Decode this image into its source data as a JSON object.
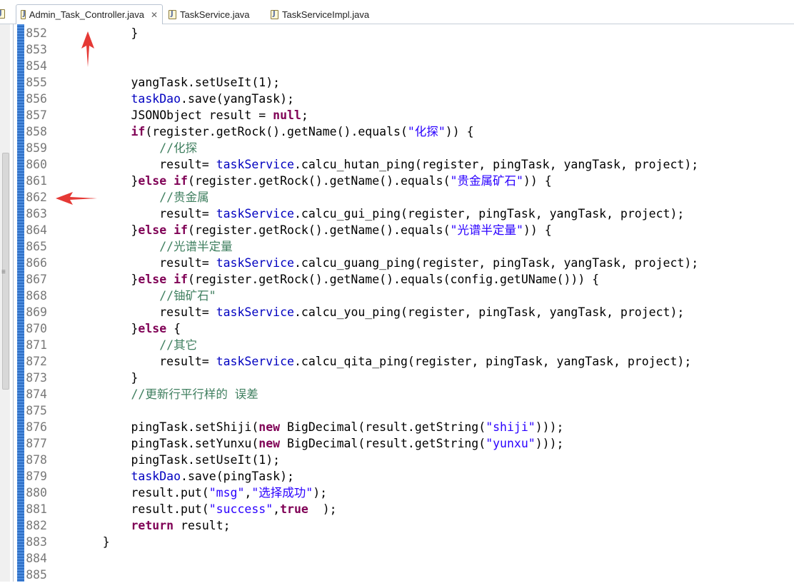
{
  "tabs": [
    {
      "label": "Admin_Task_Controller.java",
      "active": true
    },
    {
      "label": "TaskService.java",
      "active": false
    },
    {
      "label": "TaskServiceImpl.java",
      "active": false
    }
  ],
  "editor": {
    "lines": [
      {
        "n": "852",
        "segs": [
          {
            "t": "        }",
            "c": ""
          }
        ]
      },
      {
        "n": "853",
        "segs": []
      },
      {
        "n": "854",
        "segs": []
      },
      {
        "n": "855",
        "segs": [
          {
            "t": "        yangTask.setUseIt(1);",
            "c": ""
          }
        ]
      },
      {
        "n": "856",
        "segs": [
          {
            "t": "        ",
            "c": ""
          },
          {
            "t": "taskDao",
            "c": "fld"
          },
          {
            "t": ".save(yangTask);",
            "c": ""
          }
        ]
      },
      {
        "n": "857",
        "segs": [
          {
            "t": "        JSONObject result = ",
            "c": ""
          },
          {
            "t": "null",
            "c": "kw"
          },
          {
            "t": ";",
            "c": ""
          }
        ]
      },
      {
        "n": "858",
        "segs": [
          {
            "t": "        ",
            "c": ""
          },
          {
            "t": "if",
            "c": "kw"
          },
          {
            "t": "(register.getRock().getName().equals(",
            "c": ""
          },
          {
            "t": "\"化探\"",
            "c": "str"
          },
          {
            "t": ")) {",
            "c": ""
          }
        ]
      },
      {
        "n": "859",
        "segs": [
          {
            "t": "            ",
            "c": ""
          },
          {
            "t": "//化探",
            "c": "cm"
          }
        ]
      },
      {
        "n": "860",
        "segs": [
          {
            "t": "            result= ",
            "c": ""
          },
          {
            "t": "taskService",
            "c": "fld"
          },
          {
            "t": ".calcu_hutan_ping(register, pingTask, yangTask, project);",
            "c": ""
          }
        ]
      },
      {
        "n": "861",
        "segs": [
          {
            "t": "        }",
            "c": ""
          },
          {
            "t": "else if",
            "c": "kw"
          },
          {
            "t": "(register.getRock().getName().equals(",
            "c": ""
          },
          {
            "t": "\"贵金属矿石\"",
            "c": "str"
          },
          {
            "t": ")) {",
            "c": ""
          }
        ]
      },
      {
        "n": "862",
        "segs": [
          {
            "t": "            ",
            "c": ""
          },
          {
            "t": "//贵金属",
            "c": "cm"
          }
        ]
      },
      {
        "n": "863",
        "segs": [
          {
            "t": "            result= ",
            "c": ""
          },
          {
            "t": "taskService",
            "c": "fld"
          },
          {
            "t": ".calcu_gui_ping(register, pingTask, yangTask, project);",
            "c": ""
          }
        ]
      },
      {
        "n": "864",
        "segs": [
          {
            "t": "        }",
            "c": ""
          },
          {
            "t": "else if",
            "c": "kw"
          },
          {
            "t": "(register.getRock().getName().equals(",
            "c": ""
          },
          {
            "t": "\"光谱半定量\"",
            "c": "str"
          },
          {
            "t": ")) {",
            "c": ""
          }
        ]
      },
      {
        "n": "865",
        "segs": [
          {
            "t": "            ",
            "c": ""
          },
          {
            "t": "//光谱半定量",
            "c": "cm"
          }
        ]
      },
      {
        "n": "866",
        "segs": [
          {
            "t": "            result= ",
            "c": ""
          },
          {
            "t": "taskService",
            "c": "fld"
          },
          {
            "t": ".calcu_guang_ping(register, pingTask, yangTask, project);",
            "c": ""
          }
        ]
      },
      {
        "n": "867",
        "segs": [
          {
            "t": "        }",
            "c": ""
          },
          {
            "t": "else if",
            "c": "kw"
          },
          {
            "t": "(register.getRock().getName().equals(config.getUName())) {",
            "c": ""
          }
        ]
      },
      {
        "n": "868",
        "segs": [
          {
            "t": "            ",
            "c": ""
          },
          {
            "t": "//铀矿石\"",
            "c": "cm"
          }
        ]
      },
      {
        "n": "869",
        "segs": [
          {
            "t": "            result= ",
            "c": ""
          },
          {
            "t": "taskService",
            "c": "fld"
          },
          {
            "t": ".calcu_you_ping(register, pingTask, yangTask, project);",
            "c": ""
          }
        ]
      },
      {
        "n": "870",
        "segs": [
          {
            "t": "        }",
            "c": ""
          },
          {
            "t": "else",
            "c": "kw"
          },
          {
            "t": " {",
            "c": ""
          }
        ]
      },
      {
        "n": "871",
        "segs": [
          {
            "t": "            ",
            "c": ""
          },
          {
            "t": "//其它",
            "c": "cm"
          }
        ]
      },
      {
        "n": "872",
        "segs": [
          {
            "t": "            result= ",
            "c": ""
          },
          {
            "t": "taskService",
            "c": "fld"
          },
          {
            "t": ".calcu_qita_ping(register, pingTask, yangTask, project);",
            "c": ""
          }
        ]
      },
      {
        "n": "873",
        "segs": [
          {
            "t": "        }",
            "c": ""
          }
        ]
      },
      {
        "n": "874",
        "segs": [
          {
            "t": "        ",
            "c": ""
          },
          {
            "t": "//更新行平行样的 误差",
            "c": "cm"
          }
        ]
      },
      {
        "n": "875",
        "segs": []
      },
      {
        "n": "876",
        "segs": [
          {
            "t": "        pingTask.setShiji(",
            "c": ""
          },
          {
            "t": "new",
            "c": "kw"
          },
          {
            "t": " BigDecimal(result.getString(",
            "c": ""
          },
          {
            "t": "\"shiji\"",
            "c": "str"
          },
          {
            "t": ")));",
            "c": ""
          }
        ]
      },
      {
        "n": "877",
        "segs": [
          {
            "t": "        pingTask.setYunxu(",
            "c": ""
          },
          {
            "t": "new",
            "c": "kw"
          },
          {
            "t": " BigDecimal(result.getString(",
            "c": ""
          },
          {
            "t": "\"yunxu\"",
            "c": "str"
          },
          {
            "t": ")));",
            "c": ""
          }
        ]
      },
      {
        "n": "878",
        "segs": [
          {
            "t": "        pingTask.setUseIt(1);",
            "c": ""
          }
        ]
      },
      {
        "n": "879",
        "segs": [
          {
            "t": "        ",
            "c": ""
          },
          {
            "t": "taskDao",
            "c": "fld"
          },
          {
            "t": ".save(pingTask);",
            "c": ""
          }
        ]
      },
      {
        "n": "880",
        "segs": [
          {
            "t": "        result.put(",
            "c": ""
          },
          {
            "t": "\"msg\"",
            "c": "str"
          },
          {
            "t": ",",
            "c": ""
          },
          {
            "t": "\"选择成功\"",
            "c": "str"
          },
          {
            "t": ");",
            "c": ""
          }
        ]
      },
      {
        "n": "881",
        "segs": [
          {
            "t": "        result.put(",
            "c": ""
          },
          {
            "t": "\"success\"",
            "c": "str"
          },
          {
            "t": ",",
            "c": ""
          },
          {
            "t": "true",
            "c": "kw"
          },
          {
            "t": "  );",
            "c": ""
          }
        ]
      },
      {
        "n": "882",
        "segs": [
          {
            "t": "        ",
            "c": ""
          },
          {
            "t": "return",
            "c": "kw"
          },
          {
            "t": " result;",
            "c": ""
          }
        ]
      },
      {
        "n": "883",
        "segs": [
          {
            "t": "    }",
            "c": ""
          }
        ]
      },
      {
        "n": "884",
        "segs": []
      },
      {
        "n": "885",
        "segs": []
      }
    ]
  },
  "colors": {
    "keyword": "#7f0055",
    "field": "#0000c0",
    "string": "#2a00ff",
    "comment": "#3f7f5f",
    "annotation_arrow": "#e53935"
  },
  "icons": {
    "tab_file": "java-file-icon",
    "tab_close": "close-icon"
  }
}
